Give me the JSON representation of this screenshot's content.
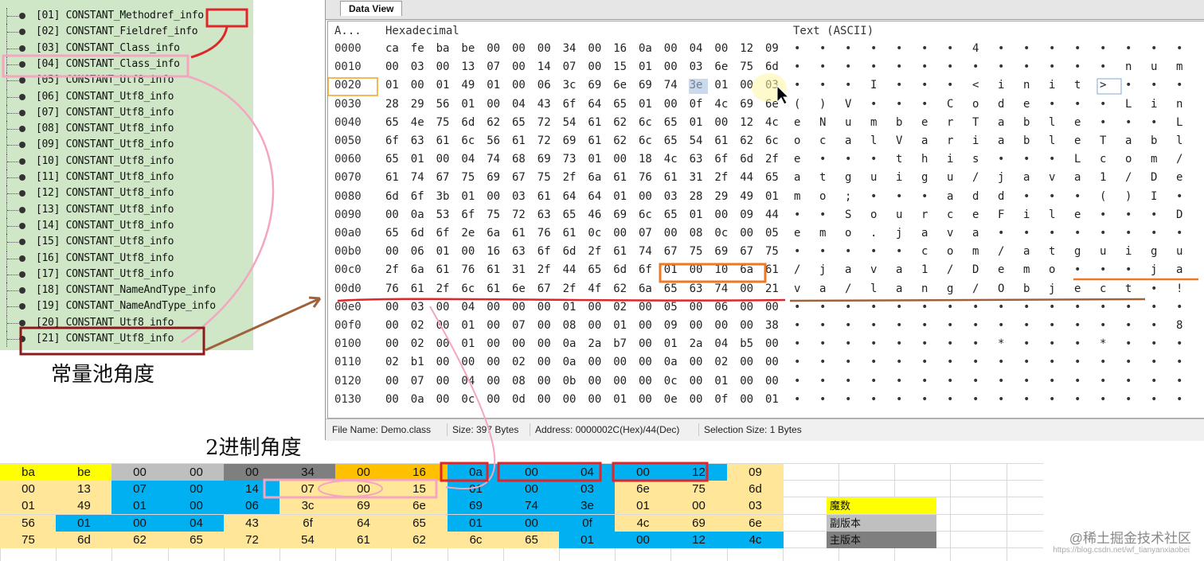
{
  "tree_items": [
    "[01] CONSTANT_Methodref_info",
    "[02] CONSTANT_Fieldref_info",
    "[03] CONSTANT_Class_info",
    "[04] CONSTANT_Class_info",
    "[05] CONSTANT_Utf8_info",
    "[06] CONSTANT_Utf8_info",
    "[07] CONSTANT_Utf8_info",
    "[08] CONSTANT_Utf8_info",
    "[09] CONSTANT_Utf8_info",
    "[10] CONSTANT_Utf8_info",
    "[11] CONSTANT_Utf8_info",
    "[12] CONSTANT_Utf8_info",
    "[13] CONSTANT_Utf8_info",
    "[14] CONSTANT_Utf8_info",
    "[15] CONSTANT_Utf8_info",
    "[16] CONSTANT_Utf8_info",
    "[17] CONSTANT_Utf8_info",
    "[18] CONSTANT_NameAndType_info",
    "[19] CONSTANT_NameAndType_info",
    "[20] CONSTANT_Utf8_info",
    "[21] CONSTANT_Utf8_info"
  ],
  "caption_pool": "常量池角度",
  "caption_binary": "2进制角度",
  "data_view": {
    "tab": "Data View",
    "col_addr": "A...",
    "col_hex": "Hexadecimal",
    "col_text": "Text (ASCII)",
    "rows": [
      {
        "a": "0000",
        "h": [
          "ca",
          "fe",
          "ba",
          "be",
          "00",
          "00",
          "00",
          "34",
          "00",
          "16",
          "0a",
          "00",
          "04",
          "00",
          "12",
          "09"
        ],
        "t": [
          "•",
          "•",
          "•",
          "•",
          "•",
          "•",
          "•",
          "4",
          "•",
          "•",
          "•",
          "•",
          "•",
          "•",
          "•",
          "•"
        ]
      },
      {
        "a": "0010",
        "h": [
          "00",
          "03",
          "00",
          "13",
          "07",
          "00",
          "14",
          "07",
          "00",
          "15",
          "01",
          "00",
          "03",
          "6e",
          "75",
          "6d"
        ],
        "t": [
          "•",
          "•",
          "•",
          "•",
          "•",
          "•",
          "•",
          "•",
          "•",
          "•",
          "•",
          "•",
          "•",
          "n",
          "u",
          "m"
        ]
      },
      {
        "a": "0020",
        "h": [
          "01",
          "00",
          "01",
          "49",
          "01",
          "00",
          "06",
          "3c",
          "69",
          "6e",
          "69",
          "74",
          "3e",
          "01",
          "00",
          "03"
        ],
        "t": [
          "•",
          "•",
          "•",
          "I",
          "•",
          "•",
          "•",
          "<",
          "i",
          "n",
          "i",
          "t",
          ">",
          "•",
          "•",
          "•"
        ]
      },
      {
        "a": "0030",
        "h": [
          "28",
          "29",
          "56",
          "01",
          "00",
          "04",
          "43",
          "6f",
          "64",
          "65",
          "01",
          "00",
          "0f",
          "4c",
          "69",
          "6e"
        ],
        "t": [
          "(",
          ")",
          "V",
          "•",
          "•",
          "•",
          "C",
          "o",
          "d",
          "e",
          "•",
          "•",
          "•",
          "L",
          "i",
          "n"
        ]
      },
      {
        "a": "0040",
        "h": [
          "65",
          "4e",
          "75",
          "6d",
          "62",
          "65",
          "72",
          "54",
          "61",
          "62",
          "6c",
          "65",
          "01",
          "00",
          "12",
          "4c"
        ],
        "t": [
          "e",
          "N",
          "u",
          "m",
          "b",
          "e",
          "r",
          "T",
          "a",
          "b",
          "l",
          "e",
          "•",
          "•",
          "•",
          "L"
        ]
      },
      {
        "a": "0050",
        "h": [
          "6f",
          "63",
          "61",
          "6c",
          "56",
          "61",
          "72",
          "69",
          "61",
          "62",
          "6c",
          "65",
          "54",
          "61",
          "62",
          "6c"
        ],
        "t": [
          "o",
          "c",
          "a",
          "l",
          "V",
          "a",
          "r",
          "i",
          "a",
          "b",
          "l",
          "e",
          "T",
          "a",
          "b",
          "l"
        ]
      },
      {
        "a": "0060",
        "h": [
          "65",
          "01",
          "00",
          "04",
          "74",
          "68",
          "69",
          "73",
          "01",
          "00",
          "18",
          "4c",
          "63",
          "6f",
          "6d",
          "2f"
        ],
        "t": [
          "e",
          "•",
          "•",
          "•",
          "t",
          "h",
          "i",
          "s",
          "•",
          "•",
          "•",
          "L",
          "c",
          "o",
          "m",
          "/"
        ]
      },
      {
        "a": "0070",
        "h": [
          "61",
          "74",
          "67",
          "75",
          "69",
          "67",
          "75",
          "2f",
          "6a",
          "61",
          "76",
          "61",
          "31",
          "2f",
          "44",
          "65"
        ],
        "t": [
          "a",
          "t",
          "g",
          "u",
          "i",
          "g",
          "u",
          "/",
          "j",
          "a",
          "v",
          "a",
          "1",
          "/",
          "D",
          "e"
        ]
      },
      {
        "a": "0080",
        "h": [
          "6d",
          "6f",
          "3b",
          "01",
          "00",
          "03",
          "61",
          "64",
          "64",
          "01",
          "00",
          "03",
          "28",
          "29",
          "49",
          "01"
        ],
        "t": [
          "m",
          "o",
          ";",
          "•",
          "•",
          "•",
          "a",
          "d",
          "d",
          "•",
          "•",
          "•",
          "(",
          ")",
          "I",
          "•"
        ]
      },
      {
        "a": "0090",
        "h": [
          "00",
          "0a",
          "53",
          "6f",
          "75",
          "72",
          "63",
          "65",
          "46",
          "69",
          "6c",
          "65",
          "01",
          "00",
          "09",
          "44"
        ],
        "t": [
          "•",
          "•",
          "S",
          "o",
          "u",
          "r",
          "c",
          "e",
          "F",
          "i",
          "l",
          "e",
          "•",
          "•",
          "•",
          "D"
        ]
      },
      {
        "a": "00a0",
        "h": [
          "65",
          "6d",
          "6f",
          "2e",
          "6a",
          "61",
          "76",
          "61",
          "0c",
          "00",
          "07",
          "00",
          "08",
          "0c",
          "00",
          "05"
        ],
        "t": [
          "e",
          "m",
          "o",
          ".",
          "j",
          "a",
          "v",
          "a",
          "•",
          "•",
          "•",
          "•",
          "•",
          "•",
          "•",
          "•"
        ]
      },
      {
        "a": "00b0",
        "h": [
          "00",
          "06",
          "01",
          "00",
          "16",
          "63",
          "6f",
          "6d",
          "2f",
          "61",
          "74",
          "67",
          "75",
          "69",
          "67",
          "75"
        ],
        "t": [
          "•",
          "•",
          "•",
          "•",
          "•",
          "c",
          "o",
          "m",
          "/",
          "a",
          "t",
          "g",
          "u",
          "i",
          "g",
          "u"
        ]
      },
      {
        "a": "00c0",
        "h": [
          "2f",
          "6a",
          "61",
          "76",
          "61",
          "31",
          "2f",
          "44",
          "65",
          "6d",
          "6f",
          "01",
          "00",
          "10",
          "6a",
          "61"
        ],
        "t": [
          "/",
          "j",
          "a",
          "v",
          "a",
          "1",
          "/",
          "D",
          "e",
          "m",
          "o",
          "•",
          "•",
          "•",
          "j",
          "a"
        ]
      },
      {
        "a": "00d0",
        "h": [
          "76",
          "61",
          "2f",
          "6c",
          "61",
          "6e",
          "67",
          "2f",
          "4f",
          "62",
          "6a",
          "65",
          "63",
          "74",
          "00",
          "21"
        ],
        "t": [
          "v",
          "a",
          "/",
          "l",
          "a",
          "n",
          "g",
          "/",
          "O",
          "b",
          "j",
          "e",
          "c",
          "t",
          "•",
          "!"
        ]
      },
      {
        "a": "00e0",
        "h": [
          "00",
          "03",
          "00",
          "04",
          "00",
          "00",
          "00",
          "01",
          "00",
          "02",
          "00",
          "05",
          "00",
          "06",
          "00",
          "00"
        ],
        "t": [
          "•",
          "•",
          "•",
          "•",
          "•",
          "•",
          "•",
          "•",
          "•",
          "•",
          "•",
          "•",
          "•",
          "•",
          "•",
          "•"
        ]
      },
      {
        "a": "00f0",
        "h": [
          "00",
          "02",
          "00",
          "01",
          "00",
          "07",
          "00",
          "08",
          "00",
          "01",
          "00",
          "09",
          "00",
          "00",
          "00",
          "38"
        ],
        "t": [
          "•",
          "•",
          "•",
          "•",
          "•",
          "•",
          "•",
          "•",
          "•",
          "•",
          "•",
          "•",
          "•",
          "•",
          "•",
          "8"
        ]
      },
      {
        "a": "0100",
        "h": [
          "00",
          "02",
          "00",
          "01",
          "00",
          "00",
          "00",
          "0a",
          "2a",
          "b7",
          "00",
          "01",
          "2a",
          "04",
          "b5",
          "00"
        ],
        "t": [
          "•",
          "•",
          "•",
          "•",
          "•",
          "•",
          "•",
          "•",
          "*",
          "•",
          "•",
          "•",
          "*",
          "•",
          "•",
          "•"
        ]
      },
      {
        "a": "0110",
        "h": [
          "02",
          "b1",
          "00",
          "00",
          "00",
          "02",
          "00",
          "0a",
          "00",
          "00",
          "00",
          "0a",
          "00",
          "02",
          "00",
          "00"
        ],
        "t": [
          "•",
          "•",
          "•",
          "•",
          "•",
          "•",
          "•",
          "•",
          "•",
          "•",
          "•",
          "•",
          "•",
          "•",
          "•",
          "•"
        ]
      },
      {
        "a": "0120",
        "h": [
          "00",
          "07",
          "00",
          "04",
          "00",
          "08",
          "00",
          "0b",
          "00",
          "00",
          "00",
          "0c",
          "00",
          "01",
          "00",
          "00"
        ],
        "t": [
          "•",
          "•",
          "•",
          "•",
          "•",
          "•",
          "•",
          "•",
          "•",
          "•",
          "•",
          "•",
          "•",
          "•",
          "•",
          "•"
        ]
      },
      {
        "a": "0130",
        "h": [
          "00",
          "0a",
          "00",
          "0c",
          "00",
          "0d",
          "00",
          "00",
          "00",
          "01",
          "00",
          "0e",
          "00",
          "0f",
          "00",
          "01"
        ],
        "t": [
          "•",
          "•",
          "•",
          "•",
          "•",
          "•",
          "•",
          "•",
          "•",
          "•",
          "•",
          "•",
          "•",
          "•",
          "•",
          "•"
        ]
      }
    ],
    "status": {
      "file_name": "File Name: Demo.class",
      "size": "Size: 397 Bytes",
      "address": "Address: 0000002C(Hex)/44(Dec)",
      "selection": "Selection Size: 1 Bytes"
    }
  },
  "sheet": {
    "rows": [
      [
        "ba",
        "be",
        "00",
        "00",
        "00",
        "34",
        "00",
        "16",
        "0a",
        "00",
        "04",
        "00",
        "12",
        "09"
      ],
      [
        "00",
        "13",
        "07",
        "00",
        "14",
        "07",
        "00",
        "15",
        "01",
        "00",
        "03",
        "6e",
        "75",
        "6d"
      ],
      [
        "01",
        "49",
        "01",
        "00",
        "06",
        "3c",
        "69",
        "6e",
        "69",
        "74",
        "3e",
        "01",
        "00",
        "03"
      ],
      [
        "56",
        "01",
        "00",
        "04",
        "43",
        "6f",
        "64",
        "65",
        "01",
        "00",
        "0f",
        "4c",
        "69",
        "6e"
      ],
      [
        "75",
        "6d",
        "62",
        "65",
        "72",
        "54",
        "61",
        "62",
        "6c",
        "65",
        "01",
        "00",
        "12",
        "4c"
      ]
    ],
    "colors": [
      [
        "#ffff00",
        "#ffff00",
        "#bfbfbf",
        "#bfbfbf",
        "#7f7f7f",
        "#7f7f7f",
        "#ffc000",
        "#ffc000",
        "#00b0f0",
        "#00b0f0",
        "#00b0f0",
        "#00b0f0",
        "#00b0f0",
        "#ffe699"
      ],
      [
        "#ffe699",
        "#ffe699",
        "#00b0f0",
        "#00b0f0",
        "#00b0f0",
        "#ffe699",
        "#ffe699",
        "#ffe699",
        "#00b0f0",
        "#00b0f0",
        "#00b0f0",
        "#ffe699",
        "#ffe699",
        "#ffe699"
      ],
      [
        "#ffe699",
        "#ffe699",
        "#00b0f0",
        "#00b0f0",
        "#00b0f0",
        "#ffe699",
        "#ffe699",
        "#ffe699",
        "#00b0f0",
        "#00b0f0",
        "#00b0f0",
        "#ffe699",
        "#ffe699",
        "#ffe699"
      ],
      [
        "#ffe699",
        "#00b0f0",
        "#00b0f0",
        "#00b0f0",
        "#ffe699",
        "#ffe699",
        "#ffe699",
        "#ffe699",
        "#00b0f0",
        "#00b0f0",
        "#00b0f0",
        "#ffe699",
        "#ffe699",
        "#ffe699"
      ],
      [
        "#ffe699",
        "#ffe699",
        "#ffe699",
        "#ffe699",
        "#ffe699",
        "#ffe699",
        "#ffe699",
        "#ffe699",
        "#ffe699",
        "#ffe699",
        "#00b0f0",
        "#00b0f0",
        "#00b0f0",
        "#00b0f0"
      ]
    ],
    "legend": [
      {
        "label": "魔数",
        "color": "#ffff00"
      },
      {
        "label": "副版本",
        "color": "#bfbfbf"
      },
      {
        "label": "主版本",
        "color": "#7f7f7f"
      }
    ]
  },
  "watermark": "@稀土掘金技术社区",
  "watermark_small": "https://blog.csdn.net/wf_tianyanxiaobei"
}
